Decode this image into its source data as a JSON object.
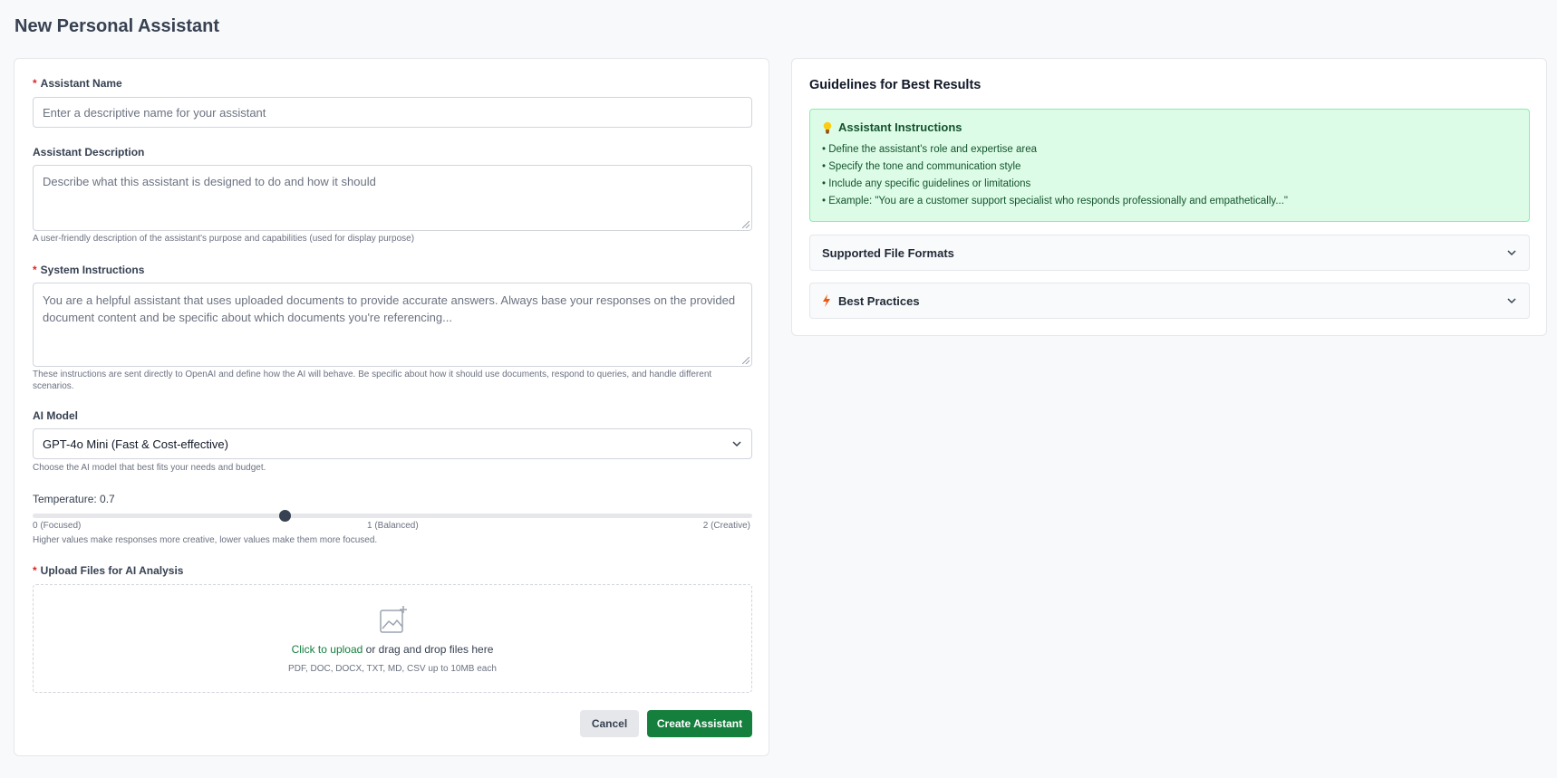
{
  "page": {
    "title": "New Personal Assistant"
  },
  "form": {
    "name": {
      "label": "Assistant Name",
      "required_mark": "*",
      "placeholder": "Enter a descriptive name for your assistant"
    },
    "description": {
      "label": "Assistant Description",
      "placeholder": "Describe what this assistant is designed to do and how it should",
      "help": "A user-friendly description of the assistant's purpose and capabilities (used for display purpose)"
    },
    "instructions": {
      "label": "System Instructions",
      "required_mark": "*",
      "placeholder": "You are a helpful assistant that uses uploaded documents to provide accurate answers. Always base your responses on the provided document content and be specific about which documents you're referencing...",
      "help": "These instructions are sent directly to OpenAI and define how the AI will behave. Be specific about how it should use documents, respond to queries, and handle different scenarios."
    },
    "model": {
      "label": "AI Model",
      "value": "GPT-4o Mini (Fast & Cost-effective)",
      "help": "Choose the AI model that best fits your needs and budget."
    },
    "temperature": {
      "label": "Temperature: 0.7",
      "value": 0.7,
      "min": 0,
      "max": 2,
      "min_label": "0 (Focused)",
      "mid_label": "1 (Balanced)",
      "max_label": "2 (Creative)",
      "help": "Higher values make responses more creative, lower values make them more focused."
    },
    "upload": {
      "label": "Upload Files for AI Analysis",
      "required_mark": "*",
      "link": "Click to upload",
      "text": " or drag and drop files here",
      "formats": "PDF, DOC, DOCX, TXT, MD, CSV up to 10MB each",
      "icon": "image-plus-icon"
    },
    "buttons": {
      "cancel": "Cancel",
      "create": "Create Assistant"
    }
  },
  "guidelines": {
    "title": "Guidelines for Best Results",
    "instructions_box": {
      "icon": "lightbulb-icon",
      "title": "Assistant Instructions",
      "items": [
        "• Define the assistant's role and expertise area",
        "• Specify the tone and communication style",
        "• Include any specific guidelines or limitations",
        "• Example: \"You are a customer support specialist who responds professionally and empathetically...\""
      ]
    },
    "sections": [
      {
        "title": "Supported File Formats"
      },
      {
        "title": "Best Practices",
        "icon": "lightning-icon"
      }
    ]
  },
  "colors": {
    "accent": "#15803d",
    "info_bg": "#dcfce7",
    "required": "#dc2626"
  }
}
